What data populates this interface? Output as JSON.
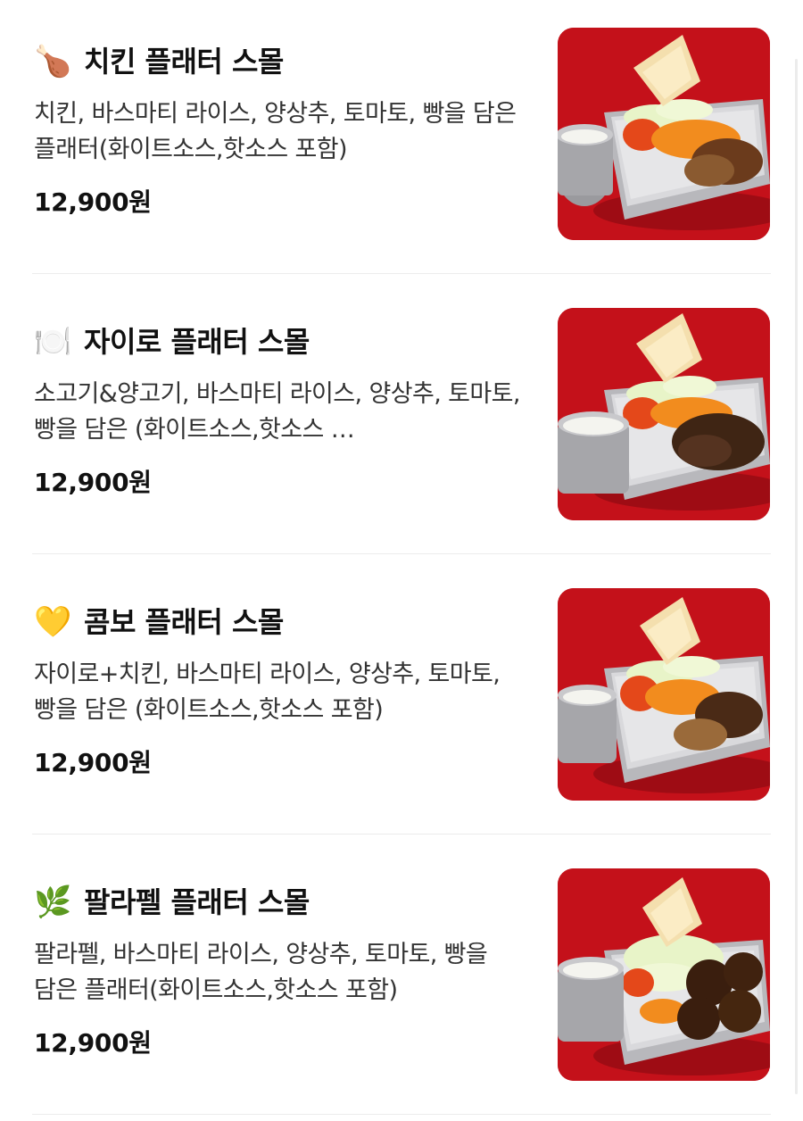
{
  "menu": {
    "items": [
      {
        "emoji": "🍗",
        "icon": "chicken-leg-icon",
        "name": "치킨 플래터 스몰",
        "description": "치킨, 바스마티 라이스, 양상추, 토마토, 빵을 담은 플래터(화이트소스,핫소스 포함)",
        "price": "12,900원",
        "photo": "chicken-platter-photo"
      },
      {
        "emoji": "🍽️",
        "icon": "plate-cutlery-icon",
        "name": "자이로 플래터 스몰",
        "description": "소고기&양고기, 바스마티 라이스, 양상추, 토마토, 빵을 담은 (화이트소스,핫소스 …",
        "price": "12,900원",
        "photo": "gyro-platter-photo"
      },
      {
        "emoji": "💛",
        "icon": "yellow-heart-icon",
        "name": "콤보 플래터 스몰",
        "description": "자이로+치킨, 바스마티 라이스, 양상추, 토마토, 빵을 담은 (화이트소스,핫소스 포함)",
        "price": "12,900원",
        "photo": "combo-platter-photo"
      },
      {
        "emoji": "🌿",
        "icon": "herb-icon",
        "name": "팔라펠 플래터 스몰",
        "description": "팔라펠, 바스마티 라이스, 양상추, 토마토, 빵을 담은 플래터(화이트소스,핫소스 포함)",
        "price": "12,900원",
        "photo": "falafel-platter-photo"
      }
    ]
  },
  "colors": {
    "photo_background": "#c4111a",
    "divider": "#ececec",
    "text_primary": "#111111",
    "text_secondary": "#333333"
  }
}
